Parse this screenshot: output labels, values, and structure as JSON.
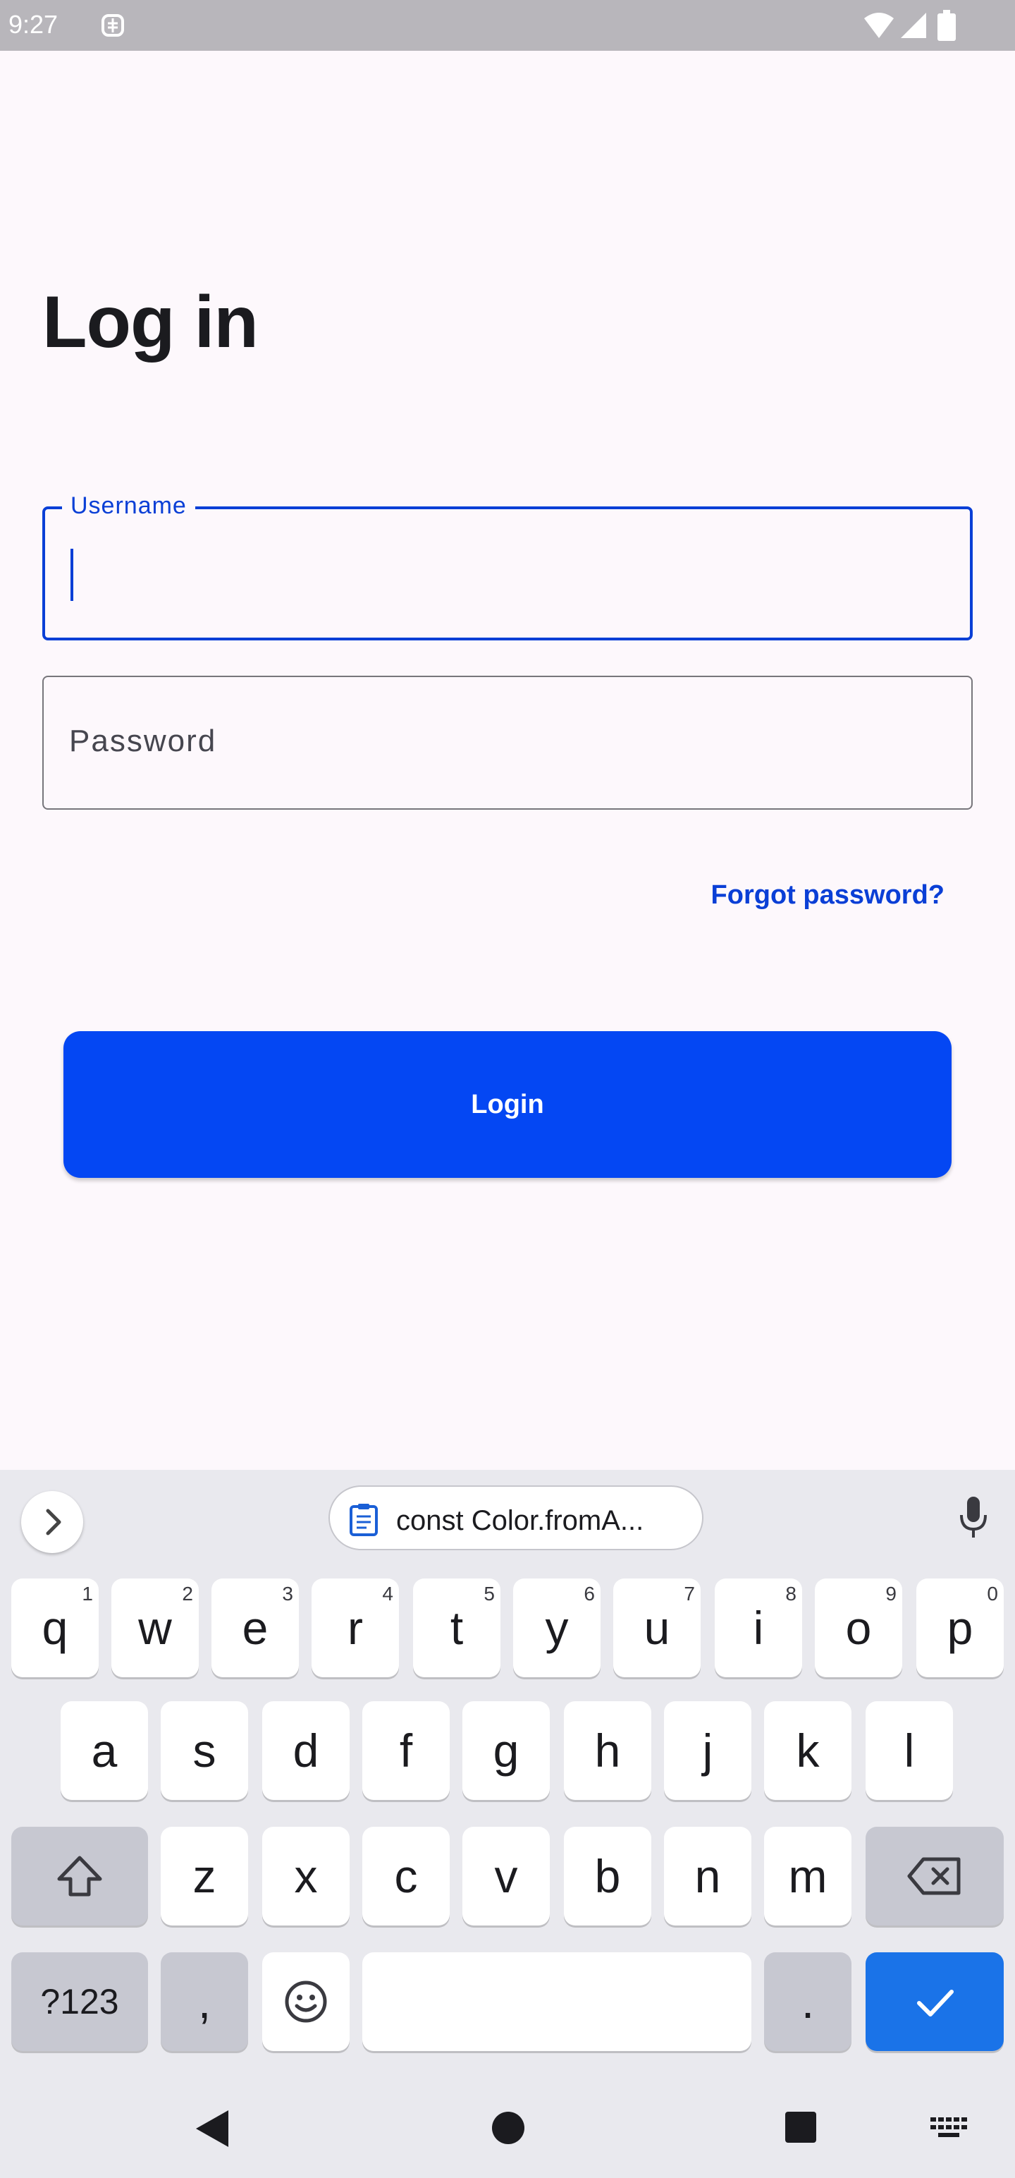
{
  "status_bar": {
    "time": "9:27"
  },
  "title": "Log in",
  "username": {
    "label": "Username",
    "value": ""
  },
  "password": {
    "placeholder": "Password"
  },
  "forgot_password": "Forgot password?",
  "login_button": "Login",
  "keyboard": {
    "clipboard_text": "const Color.fromA...",
    "row1": [
      {
        "key": "q",
        "hint": "1"
      },
      {
        "key": "w",
        "hint": "2"
      },
      {
        "key": "e",
        "hint": "3"
      },
      {
        "key": "r",
        "hint": "4"
      },
      {
        "key": "t",
        "hint": "5"
      },
      {
        "key": "y",
        "hint": "6"
      },
      {
        "key": "u",
        "hint": "7"
      },
      {
        "key": "i",
        "hint": "8"
      },
      {
        "key": "o",
        "hint": "9"
      },
      {
        "key": "p",
        "hint": "0"
      }
    ],
    "row2": [
      "a",
      "s",
      "d",
      "f",
      "g",
      "h",
      "j",
      "k",
      "l"
    ],
    "row3": [
      "z",
      "x",
      "c",
      "v",
      "b",
      "n",
      "m"
    ],
    "symbols_key": "?123",
    "comma_key": ",",
    "period_key": "."
  },
  "colors": {
    "accent": "#0a3fd6",
    "button": "#0447f3",
    "background": "#fdf8fc",
    "keyboard_bg": "#e9e9ee",
    "enter_key": "#1a73e8"
  },
  "icons": [
    "app-sync-icon",
    "wifi-icon",
    "signal-icon",
    "battery-icon",
    "chevron-right-icon",
    "clipboard-icon",
    "microphone-icon",
    "shift-icon",
    "backspace-icon",
    "emoji-icon",
    "checkmark-icon",
    "back-icon",
    "home-icon",
    "recents-icon",
    "keyboard-icon"
  ]
}
